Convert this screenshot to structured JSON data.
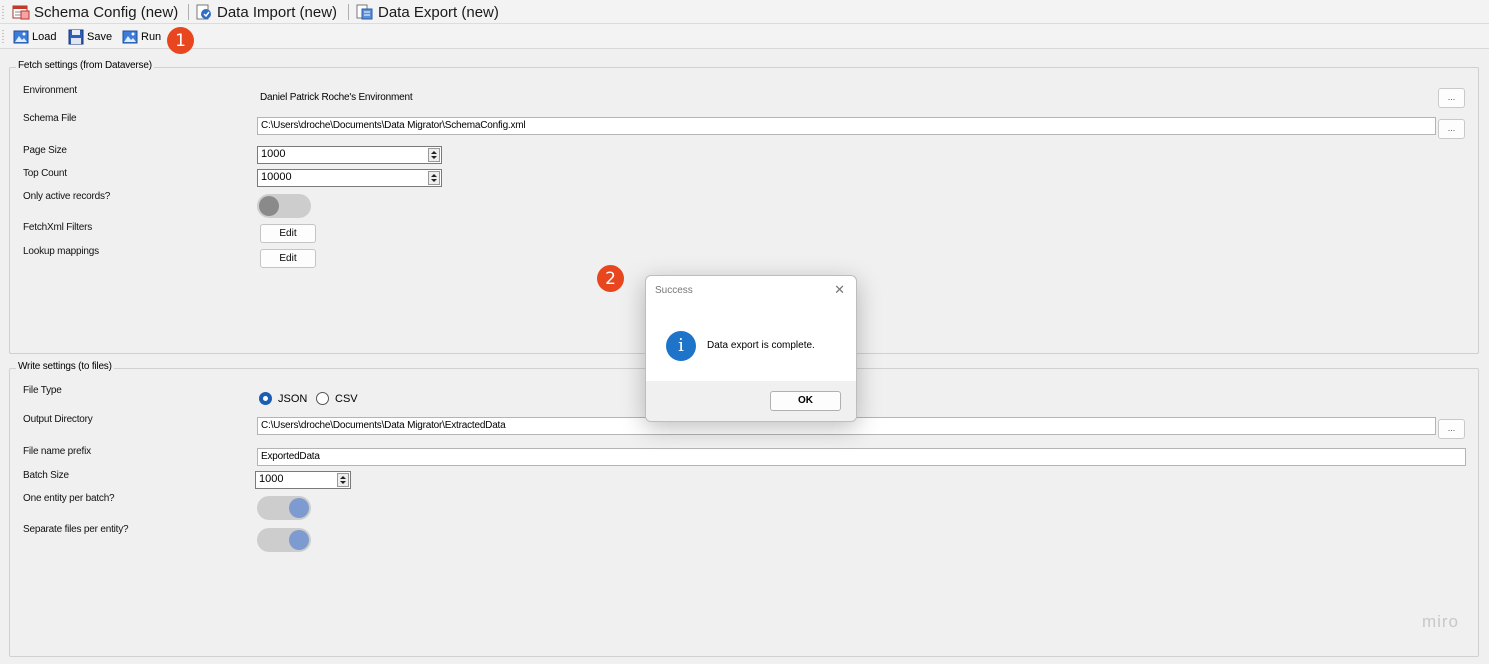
{
  "tabs": [
    {
      "label": "Schema Config (new)",
      "icon": "schema-config-icon"
    },
    {
      "label": "Data Import (new)",
      "icon": "data-import-icon"
    },
    {
      "label": "Data Export (new)",
      "icon": "data-export-icon"
    }
  ],
  "toolbar": {
    "load_label": "Load",
    "save_label": "Save",
    "run_label": "Run"
  },
  "badges": {
    "one": "1",
    "two": "2"
  },
  "fetch": {
    "title": "Fetch settings (from Dataverse)",
    "environment_label": "Environment",
    "environment_value": "Daniel Patrick Roche's Environment",
    "schema_file_label": "Schema File",
    "schema_file_value": "C:\\Users\\droche\\Documents\\Data Migrator\\SchemaConfig.xml",
    "page_size_label": "Page Size",
    "page_size_value": "1000",
    "top_count_label": "Top Count",
    "top_count_value": "10000",
    "only_active_label": "Only active records?",
    "only_active_on": false,
    "fetchxml_label": "FetchXml Filters",
    "lookup_label": "Lookup mappings",
    "edit_label": "Edit",
    "browse_label": "..."
  },
  "write": {
    "title": "Write settings (to files)",
    "file_type_label": "File Type",
    "file_type_options": [
      "JSON",
      "CSV"
    ],
    "file_type_selected": "JSON",
    "output_dir_label": "Output Directory",
    "output_dir_value": "C:\\Users\\droche\\Documents\\Data Migrator\\ExtractedData",
    "prefix_label": "File name prefix",
    "prefix_value": "ExportedData",
    "batch_size_label": "Batch Size",
    "batch_size_value": "1000",
    "one_entity_label": "One entity per batch?",
    "one_entity_on": true,
    "separate_files_label": "Separate files per entity?",
    "separate_files_on": true
  },
  "dialog": {
    "title": "Success",
    "close": "✕",
    "icon": "i",
    "message": "Data export is complete.",
    "ok_label": "OK"
  },
  "watermark": "miro"
}
